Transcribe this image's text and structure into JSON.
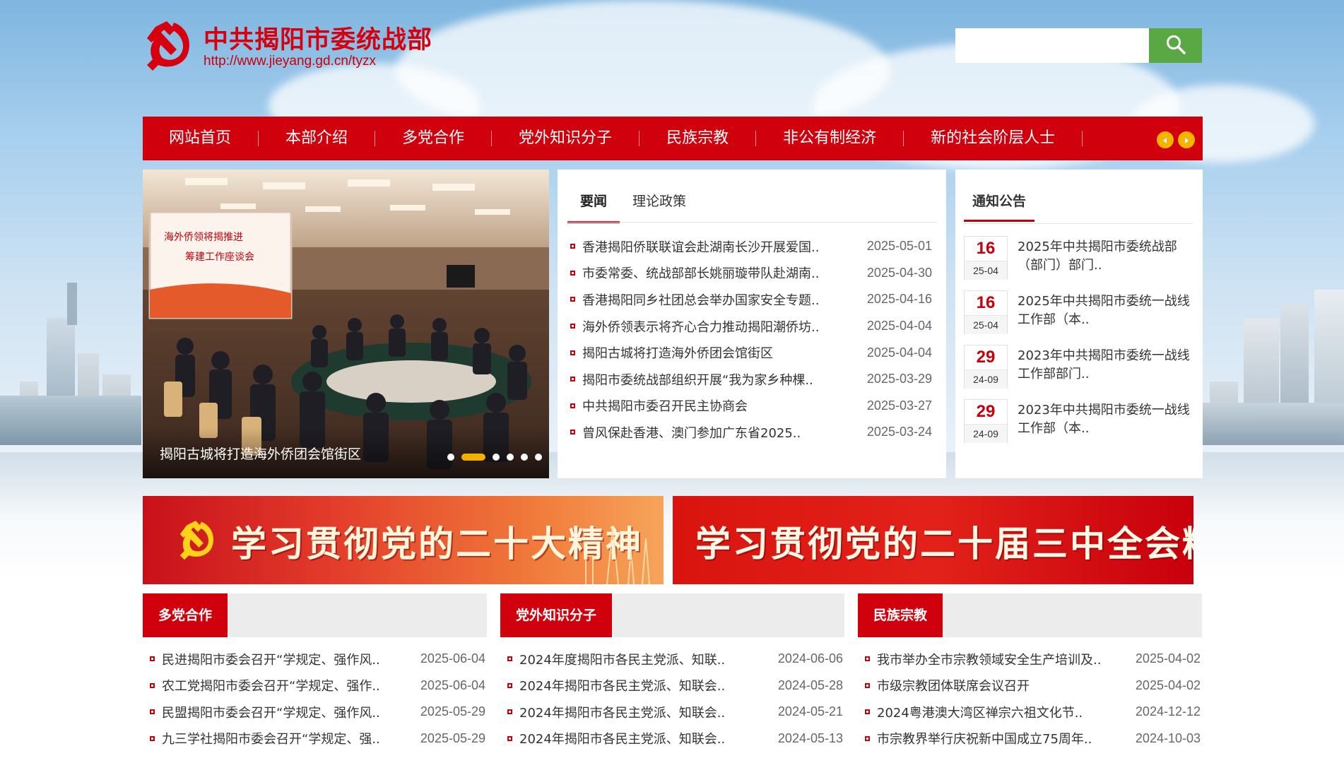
{
  "header": {
    "title": "中共揭阳市委统战部",
    "url": "http://www.jieyang.gd.cn/tyzx",
    "search_placeholder": ""
  },
  "nav": {
    "items": [
      "网站首页",
      "本部介绍",
      "多党合作",
      "党外知识分子",
      "民族宗教",
      "非公有制经济",
      "新的社会阶层人士"
    ]
  },
  "slider": {
    "caption": "揭阳古城将打造海外侨团会馆街区",
    "slide_count": 6,
    "active_index": 1
  },
  "news": {
    "tabs": [
      "要闻",
      "理论政策"
    ],
    "active_tab": 0,
    "items": [
      {
        "title": "香港揭阳侨联联谊会赴湖南长沙开展爱国..",
        "date": "2025-05-01"
      },
      {
        "title": "市委常委、统战部部长姚丽璇带队赴湖南..",
        "date": "2025-04-30"
      },
      {
        "title": "香港揭阳同乡社团总会举办国家安全专题..",
        "date": "2025-04-16"
      },
      {
        "title": "海外侨领表示将齐心合力推动揭阳潮侨坊..",
        "date": "2025-04-04"
      },
      {
        "title": "揭阳古城将打造海外侨团会馆街区",
        "date": "2025-04-04"
      },
      {
        "title": "揭阳市委统战部组织开展“我为家乡种棵..",
        "date": "2025-03-29"
      },
      {
        "title": "中共揭阳市委召开民主协商会",
        "date": "2025-03-27"
      },
      {
        "title": "曾风保赴香港、澳门参加广东省2025..",
        "date": "2025-03-24"
      }
    ]
  },
  "notice": {
    "title": "通知公告",
    "items": [
      {
        "day": "16",
        "ym": "25-04",
        "text": "2025年中共揭阳市委统战部（部门）部门.."
      },
      {
        "day": "16",
        "ym": "25-04",
        "text": "2025年中共揭阳市委统一战线工作部（本.."
      },
      {
        "day": "29",
        "ym": "24-09",
        "text": "2023年中共揭阳市委统一战线工作部部门.."
      },
      {
        "day": "29",
        "ym": "24-09",
        "text": "2023年中共揭阳市委统一战线工作部（本.."
      }
    ]
  },
  "banners": [
    {
      "text": "学习贯彻党的二十大精神"
    },
    {
      "text": "学习贯彻党的二十届三中全会精神"
    }
  ],
  "columns": [
    {
      "title": "多党合作",
      "items": [
        {
          "title": "民进揭阳市委会召开“学规定、强作风..",
          "date": "2025-06-04"
        },
        {
          "title": "农工党揭阳市委会召开“学规定、强作..",
          "date": "2025-06-04"
        },
        {
          "title": "民盟揭阳市委会召开“学规定、强作风..",
          "date": "2025-05-29"
        },
        {
          "title": "九三学社揭阳市委会召开“学规定、强..",
          "date": "2025-05-29"
        }
      ]
    },
    {
      "title": "党外知识分子",
      "items": [
        {
          "title": "2024年度揭阳市各民主党派、知联..",
          "date": "2024-06-06"
        },
        {
          "title": "2024年揭阳市各民主党派、知联会..",
          "date": "2024-05-28"
        },
        {
          "title": "2024年揭阳市各民主党派、知联会..",
          "date": "2024-05-21"
        },
        {
          "title": "2024年揭阳市各民主党派、知联会..",
          "date": "2024-05-13"
        }
      ]
    },
    {
      "title": "民族宗教",
      "items": [
        {
          "title": "我市举办全市宗教领域安全生产培训及..",
          "date": "2025-04-02"
        },
        {
          "title": "市级宗教团体联席会议召开",
          "date": "2025-04-02"
        },
        {
          "title": "2024粤港澳大湾区禅宗六祖文化节..",
          "date": "2024-12-12"
        },
        {
          "title": "市宗教界举行庆祝新中国成立75周年..",
          "date": "2024-10-03"
        }
      ]
    }
  ],
  "colors": {
    "primary_red": "#d0000d",
    "search_green": "#5aa843",
    "accent_gold": "#f2b100"
  }
}
